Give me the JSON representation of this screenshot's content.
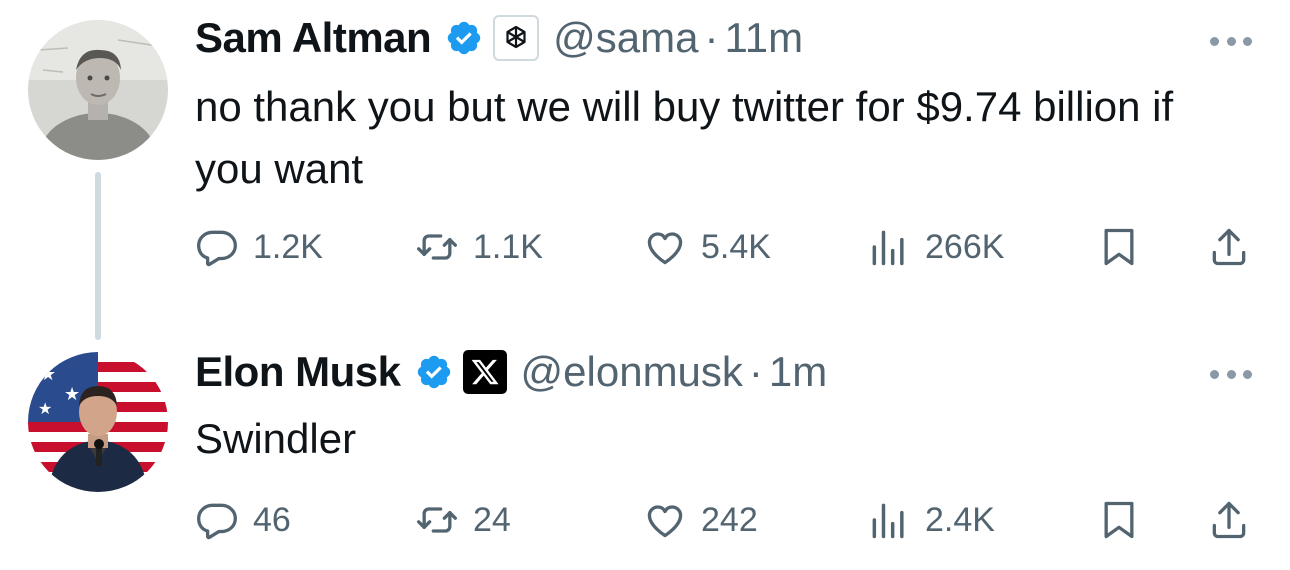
{
  "tweets": [
    {
      "author": {
        "name": "Sam Altman",
        "handle": "@sama",
        "verified": true,
        "affiliation_icon": "openai-logo-icon",
        "avatar_icon": "person-avatar-grayscale"
      },
      "separator": "·",
      "time": "11m",
      "text": "no thank you but we will buy twitter for $9.74 billion if you want",
      "actions": {
        "replies": "1.2K",
        "reposts": "1.1K",
        "likes": "5.4K",
        "views": "266K"
      }
    },
    {
      "author": {
        "name": "Elon Musk",
        "handle": "@elonmusk",
        "verified": true,
        "affiliation_icon": "x-logo-icon",
        "avatar_icon": "person-avatar-flag-background"
      },
      "separator": "·",
      "time": "1m",
      "text": "Swindler",
      "actions": {
        "replies": "46",
        "reposts": "24",
        "likes": "242",
        "views": "2.4K"
      }
    }
  ],
  "colors": {
    "text": "#0f1419",
    "secondary": "#536471",
    "verified_blue": "#1d9bf0",
    "thread_line": "#cfd9de",
    "icon_action": "#536471"
  }
}
